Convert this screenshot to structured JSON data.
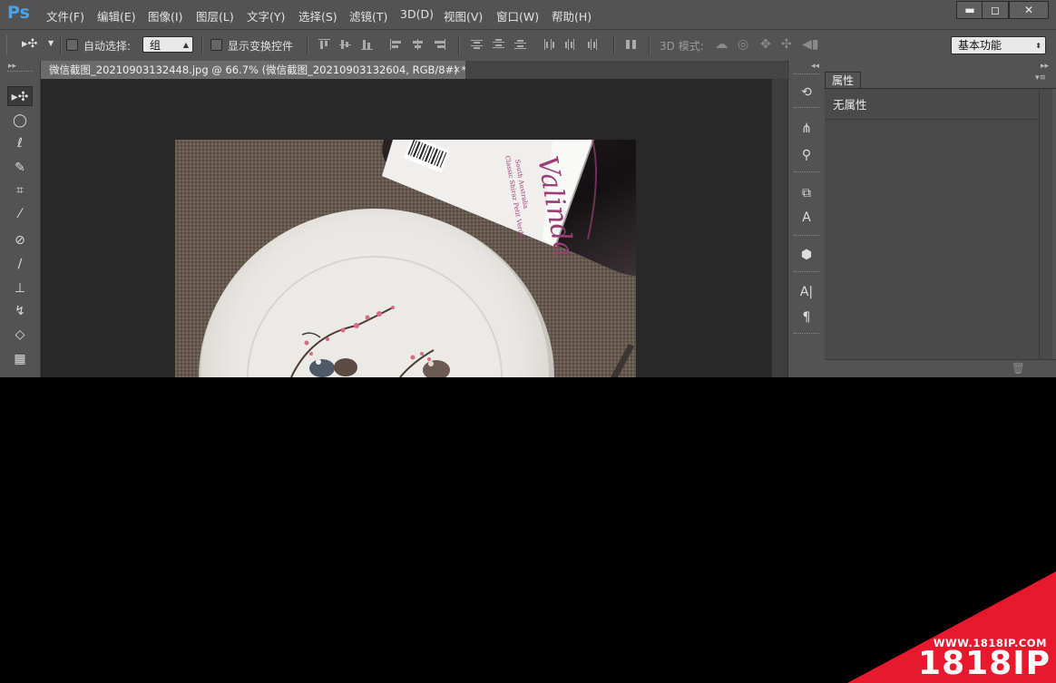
{
  "app": {
    "logo": "Ps"
  },
  "menu": [
    {
      "label": "文件(F)"
    },
    {
      "label": "编辑(E)"
    },
    {
      "label": "图像(I)"
    },
    {
      "label": "图层(L)"
    },
    {
      "label": "文字(Y)"
    },
    {
      "label": "选择(S)"
    },
    {
      "label": "滤镜(T)"
    },
    {
      "label": "3D(D)"
    },
    {
      "label": "视图(V)"
    },
    {
      "label": "窗口(W)"
    },
    {
      "label": "帮助(H)"
    }
  ],
  "window_controls": {
    "minimize": "▬",
    "restore": "◻",
    "close": "✕"
  },
  "options_bar": {
    "tool_icon": "▸✣",
    "auto_select_label": "自动选择:",
    "auto_select_value": "组",
    "show_transform_label": "显示变换控件",
    "mode_3d_label": "3D 模式:",
    "workspace_value": "基本功能"
  },
  "document": {
    "tab_title": "微信截图_20210903132448.jpg @ 66.7% (微信截图_20210903132604, RGB/8#) *",
    "close_glyph": "×"
  },
  "photo": {
    "label_script": "Valinda",
    "label_sub1": "South Australia",
    "label_sub2": "Classic Shiraz Petit Verdot"
  },
  "properties_panel": {
    "tab_label": "属性",
    "content_text": "无属性"
  },
  "watermark": {
    "url": "WWW.1818IP.COM",
    "brand": "1818IP",
    "accent_color": "#e8192c"
  }
}
